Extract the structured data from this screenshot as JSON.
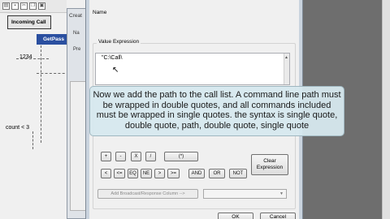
{
  "background_app": {
    "tab_label": "Incoming Call",
    "node_label": "GetPass",
    "value_text": "1234",
    "count_text": "count < 3",
    "toolbar_icons": [
      "folder-icon",
      "save-icon",
      "cut-icon",
      "copy-icon",
      "paste-icon"
    ]
  },
  "middle_window": {
    "title": "Creat",
    "label_1": "Na",
    "label_2": "Pre"
  },
  "dialog": {
    "name_label": "Name",
    "value_expression_label": "Value Expression",
    "expression_text": "\"C:\\Call\\",
    "operator_row1": [
      "+",
      "-",
      "X",
      "/",
      "(*)"
    ],
    "operator_row2": [
      "<",
      "<=",
      "EQ",
      "NE",
      ">",
      ">=",
      "AND",
      "OR",
      "NOT"
    ],
    "clear_expression": "Clear Expression",
    "add_column_button": "Add Broadcast/Response Column -->",
    "ok_button": "OK",
    "cancel_button": "Cancel"
  },
  "caption": {
    "text": "Now we add the path to the call list. A command line path must be wrapped in double quotes, and all commands included must be wrapped in single quotes. the syntax is single quote, double quote, path, double quote, single quote"
  }
}
